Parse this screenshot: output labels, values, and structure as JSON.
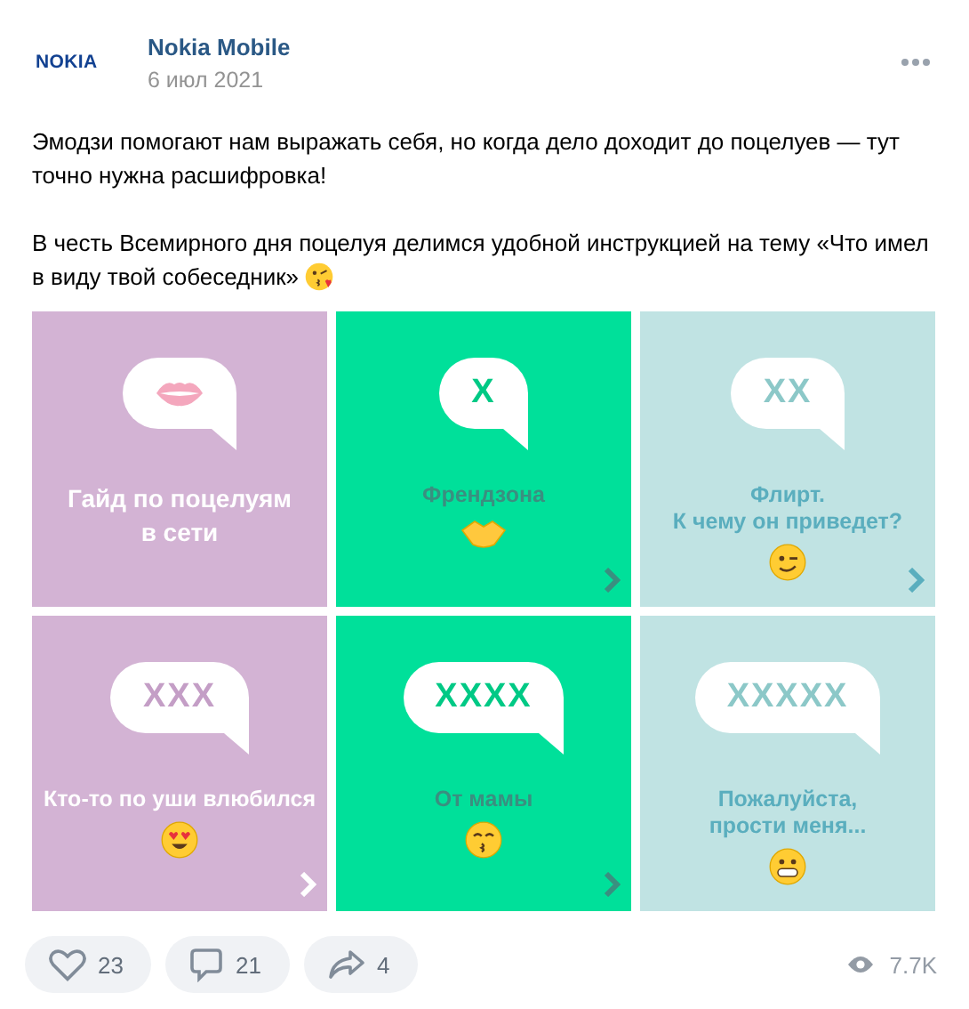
{
  "post": {
    "author": "Nokia Mobile",
    "logo": "NOKIA",
    "date": "6 июл 2021",
    "paragraphs": [
      "Эмодзи помогают нам выражать себя, но когда дело доходит до поцелуев — тут точно нужна расшифровка!",
      "В честь Всемирного дня поцелуя делимся удобной инструкцией на тему «Что имел в виду твой собеседник»"
    ]
  },
  "tiles": [
    {
      "color": "#d3b3d4",
      "caption": "Гайд по поцелуям\nв сети",
      "arrow": false
    },
    {
      "color": "#00e09a",
      "bubble": "X",
      "caption": "Френдзона",
      "arrow": true
    },
    {
      "color": "#c0e3e3",
      "bubble": "XX",
      "caption": "Флирт.\nК чему он приведет?",
      "arrow": true
    },
    {
      "color": "#d3b3d4",
      "bubble": "XXX",
      "caption": "Кто-то по уши влюбился",
      "arrow": true
    },
    {
      "color": "#00e09a",
      "bubble": "XXXX",
      "caption": "От мамы",
      "arrow": true
    },
    {
      "color": "#c0e3e3",
      "bubble": "XXXXX",
      "caption": "Пожалуйста,\nпрости меня...",
      "arrow": false
    }
  ],
  "actions": {
    "likes": "23",
    "comments": "21",
    "shares": "4",
    "views": "7.7K"
  }
}
